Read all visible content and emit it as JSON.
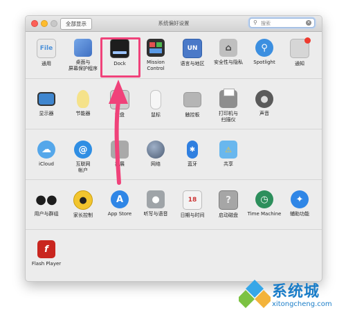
{
  "window": {
    "title": "系统偏好设置",
    "show_all_label": "全部显示",
    "search": {
      "placeholder": "搜索"
    }
  },
  "rows": [
    {
      "items": [
        {
          "label": "通用",
          "icon": "general-icon",
          "color": "#4a90d9"
        },
        {
          "label": "桌面与\n屏幕保护程序",
          "icon": "desktop-icon",
          "color": "#5b8bd6"
        },
        {
          "label": "Dock",
          "icon": "dock-icon",
          "color": "#222222"
        },
        {
          "label": "Mission\nControl",
          "icon": "mission-control-icon",
          "color": "#3a3a3a"
        },
        {
          "label": "语言与地区",
          "icon": "language-flag-icon",
          "color": "#4a79c8"
        },
        {
          "label": "安全性与隐私",
          "icon": "house-lock-icon",
          "color": "#8f8f8f"
        },
        {
          "label": "Spotlight",
          "icon": "spotlight-icon",
          "color": "#3c8fe0"
        },
        {
          "label": "通知",
          "icon": "notifications-icon",
          "color": "#c8c8c8"
        }
      ]
    },
    {
      "items": [
        {
          "label": "显示器",
          "icon": "display-icon",
          "color": "#3f86cf"
        },
        {
          "label": "节能器",
          "icon": "energy-bulb-icon",
          "color": "#f5e28a"
        },
        {
          "label": "键盘",
          "icon": "keyboard-icon",
          "color": "#bdbdbd"
        },
        {
          "label": "鼠标",
          "icon": "mouse-icon",
          "color": "#f6f6f6"
        },
        {
          "label": "触控板",
          "icon": "trackpad-icon",
          "color": "#a9a9a9"
        },
        {
          "label": "打印机与\n扫描仪",
          "icon": "printer-icon",
          "color": "#8e8e8e"
        },
        {
          "label": "声音",
          "icon": "speaker-icon",
          "color": "#555555"
        }
      ]
    },
    {
      "items": [
        {
          "label": "iCloud",
          "icon": "icloud-icon",
          "color": "#55a7ea"
        },
        {
          "label": "互联网\n帐户",
          "icon": "internet-accounts-icon",
          "color": "#2f8ee3"
        },
        {
          "label": "扩展",
          "icon": "extensions-icon",
          "color": "#9a9a9a"
        },
        {
          "label": "网络",
          "icon": "network-globe-icon",
          "color": "#6f7f95"
        },
        {
          "label": "蓝牙",
          "icon": "bluetooth-icon",
          "color": "#2f7fe0"
        },
        {
          "label": "共享",
          "icon": "sharing-folder-icon",
          "color": "#4ea7e8"
        }
      ]
    },
    {
      "items": [
        {
          "label": "用户与群组",
          "icon": "users-icon",
          "color": "#2a2a2a"
        },
        {
          "label": "家长控制",
          "icon": "parental-controls-icon",
          "color": "#f2c52e"
        },
        {
          "label": "App Store",
          "icon": "app-store-icon",
          "color": "#2f86e6"
        },
        {
          "label": "听写与语音",
          "icon": "microphone-icon",
          "color": "#9fa4a8"
        },
        {
          "label": "日期与时间",
          "icon": "calendar-clock-icon",
          "color": "#f3f3f3"
        },
        {
          "label": "启动磁盘",
          "icon": "startup-disk-icon",
          "color": "#9b9b9b"
        },
        {
          "label": "Time Machine",
          "icon": "time-machine-icon",
          "color": "#2d8f5c"
        },
        {
          "label": "辅助功能",
          "icon": "accessibility-icon",
          "color": "#2f86e6"
        }
      ]
    },
    {
      "items": [
        {
          "label": "Flash Player",
          "icon": "flash-player-icon",
          "color": "#c9261f"
        }
      ]
    }
  ],
  "watermark": {
    "brand": "系统城",
    "url": "xitongcheng.com"
  },
  "colors": {
    "highlight": "#f0427a",
    "accent": "#1a7dc8"
  }
}
